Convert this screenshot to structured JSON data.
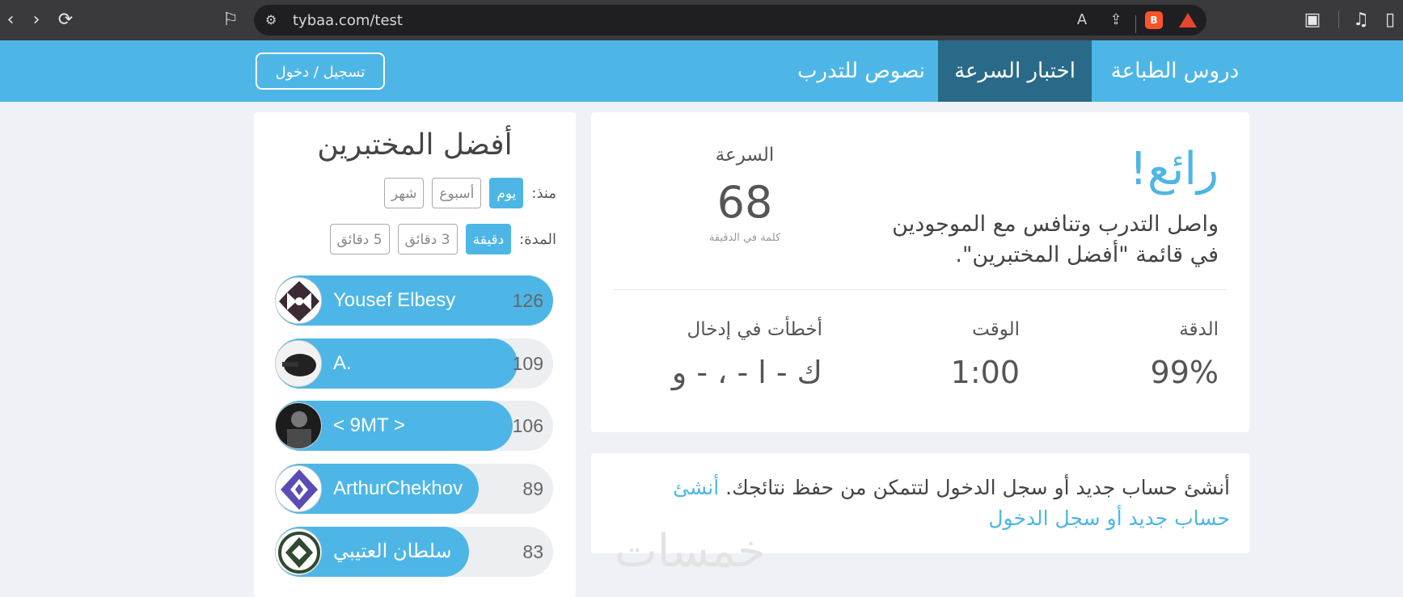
{
  "browser": {
    "url": "tybaa.com/test"
  },
  "nav": {
    "items": [
      "دروس الطباعة",
      "اختبار السرعة",
      "نصوص للتدرب"
    ],
    "login": "تسجيل / دخول"
  },
  "result": {
    "headline": "رائع!",
    "message": "واصل التدرب وتنافس مع الموجودين في قائمة \"أفضل المختبرين\".",
    "speed_label": "السرعة",
    "speed_value": "68",
    "speed_unit": "كلمة في الدقيقة",
    "accuracy_label": "الدقة",
    "accuracy_value": "99%",
    "time_label": "الوقت",
    "time_value": "1:00",
    "errors_label": "أخطأت في إدخال",
    "errors_value": "ك - ا - ، - و"
  },
  "cta": {
    "text": "أنشئ حساب جديد أو سجل الدخول لتتمكن من حفظ نتائجك.",
    "link": "أنشئ حساب جديد أو سجل الدخول"
  },
  "leaderboard": {
    "title": "أفضل المختبرين",
    "since_label": "منذ:",
    "since_options": [
      "يوم",
      "أسبوع",
      "شهر"
    ],
    "duration_label": "المدة:",
    "duration_options": [
      "دقيقة",
      "3 دقائق",
      "5 دقائق"
    ],
    "entries": [
      {
        "name": "Yousef Elbesy",
        "score": "126"
      },
      {
        "name": "A.",
        "score": "109"
      },
      {
        "name": "< 9MT >",
        "score": "106"
      },
      {
        "name": "ArthurChekhov",
        "score": "89"
      },
      {
        "name": "سلطان العتيبي",
        "score": "83"
      }
    ]
  },
  "watermark": "خمسات",
  "colors": {
    "accent": "#4db6e6",
    "nav_active": "#2a6a89"
  }
}
